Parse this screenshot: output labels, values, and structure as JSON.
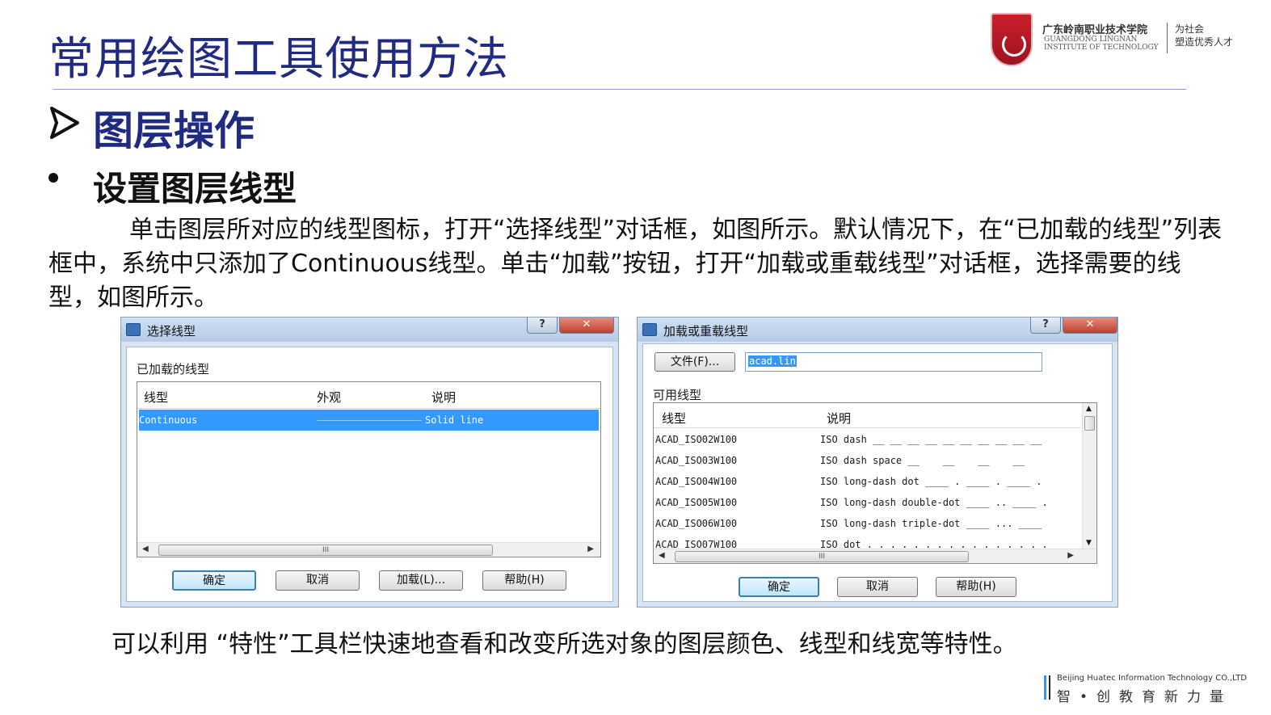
{
  "slide": {
    "title": "常用绘图工具使用方法",
    "section": "图层操作",
    "subsection": "设置图层线型",
    "paragraph": "单击图层所对应的线型图标，打开“选择线型”对话框，如图所示。默认情况下，在“已加载的线型”列表框中，系统中只添加了Continuous线型。单击“加载”按钮，打开“加载或重载线型”对话框，选择需要的线型，如图所示。",
    "bottom_text": "可以利用 “特性”工具栏快速地查看和改变所选对象的图层颜色、线型和线宽等特性。"
  },
  "logo": {
    "name_cn": "广东岭南职业技术学院",
    "name_en_line1": "GUANGDONG LINGNAN",
    "name_en_line2": "INSTITUTE OF TECHNOLOGY",
    "slogan_line1": "为社会",
    "slogan_line2": "塑造优秀人才"
  },
  "dialog_select": {
    "title": "选择线型",
    "help_button": "?",
    "close_button": "✕",
    "list_label": "已加载的线型",
    "columns": [
      "线型",
      "外观",
      "说明"
    ],
    "rows": [
      {
        "name": "Continuous",
        "appearance": "__________________",
        "desc": "Solid line"
      }
    ],
    "scroll_grip": "III",
    "buttons": {
      "ok": "确定",
      "cancel": "取消",
      "load": "加载(L)...",
      "help": "帮助(H)"
    }
  },
  "dialog_load": {
    "title": "加载或重载线型",
    "help_button": "?",
    "close_button": "✕",
    "file_button": "文件(F)...",
    "file_value": "acad.lin",
    "list_label": "可用线型",
    "columns": [
      "线型",
      "说明"
    ],
    "rows": [
      {
        "name": "ACAD_ISO02W100",
        "desc": "ISO dash __ __ __ __ __ __ __ __ __ __"
      },
      {
        "name": "ACAD_ISO03W100",
        "desc": "ISO dash space __    __    __    __"
      },
      {
        "name": "ACAD_ISO04W100",
        "desc": "ISO long-dash dot ____ . ____ . ____ ."
      },
      {
        "name": "ACAD_ISO05W100",
        "desc": "ISO long-dash double-dot ____ .. ____ ."
      },
      {
        "name": "ACAD_ISO06W100",
        "desc": "ISO long-dash triple-dot ____ ... ____"
      },
      {
        "name": "ACAD_ISO07W100",
        "desc": "ISO dot . . . . . . . . . . . . . . . ."
      }
    ],
    "scroll_grip": "III",
    "buttons": {
      "ok": "确定",
      "cancel": "取消",
      "help": "帮助(H)"
    }
  },
  "footer": {
    "company_en": "Beijing Huatec Information Technology CO.,LTD",
    "motto_cn": "智•创教育新力量"
  },
  "colors": {
    "title": "#1f2a80",
    "selection": "#3399ff",
    "dialog_bg": "#d8e4f2"
  }
}
